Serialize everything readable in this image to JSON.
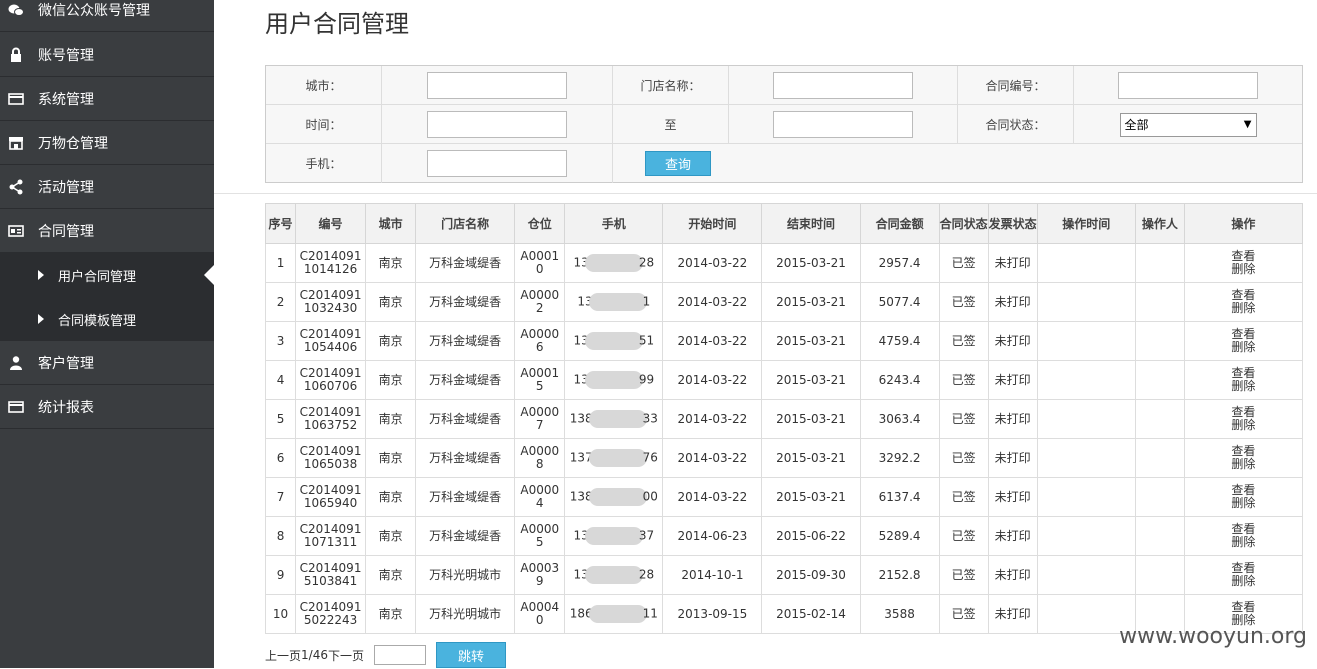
{
  "sidebar": {
    "items": [
      {
        "label": "微信公众账号管理",
        "icon": "wechat-icon"
      },
      {
        "label": "账号管理",
        "icon": "lock-icon"
      },
      {
        "label": "系统管理",
        "icon": "card-icon"
      },
      {
        "label": "万物仓管理",
        "icon": "store-icon"
      },
      {
        "label": "活动管理",
        "icon": "share-icon"
      },
      {
        "label": "合同管理",
        "icon": "contract-icon"
      },
      {
        "label": "客户管理",
        "icon": "user-icon"
      },
      {
        "label": "统计报表",
        "icon": "card-icon"
      }
    ],
    "sub_items": [
      {
        "label": "用户合同管理",
        "active": true
      },
      {
        "label": "合同模板管理",
        "active": false
      }
    ]
  },
  "page": {
    "title": "用户合同管理"
  },
  "filters": {
    "city_label": "城市：",
    "store_label": "门店名称：",
    "contract_no_label": "合同编号：",
    "time_label": "时间：",
    "to_label": "至",
    "status_label": "合同状态：",
    "status_value": "全部",
    "phone_label": "手机：",
    "query_button": "查询"
  },
  "table": {
    "headers": [
      "序号",
      "编号",
      "城市",
      "门店名称",
      "仓位",
      "手机",
      "开始时间",
      "结束时间",
      "合同金额",
      "合同状态",
      "发票状态",
      "操作时间",
      "操作人",
      "操作"
    ],
    "view_label": "查看",
    "delete_label": "删除",
    "rows": [
      {
        "idx": "1",
        "no1": "C2014091",
        "no2": "1014126",
        "city": "南京",
        "store": "万科金域缇香",
        "pos1": "A0001",
        "pos2": "0",
        "phone_a": "13",
        "phone_b": "28",
        "start": "2014-03-22",
        "end": "2015-03-21",
        "amount": "2957.4",
        "status": "已签",
        "invoice": "未打印",
        "optime": "",
        "operator": ""
      },
      {
        "idx": "2",
        "no1": "C2014091",
        "no2": "1032430",
        "city": "南京",
        "store": "万科金域缇香",
        "pos1": "A0000",
        "pos2": "2",
        "phone_a": "13",
        "phone_b": "1",
        "start": "2014-03-22",
        "end": "2015-03-21",
        "amount": "5077.4",
        "status": "已签",
        "invoice": "未打印",
        "optime": "",
        "operator": ""
      },
      {
        "idx": "3",
        "no1": "C2014091",
        "no2": "1054406",
        "city": "南京",
        "store": "万科金域缇香",
        "pos1": "A0000",
        "pos2": "6",
        "phone_a": "13",
        "phone_b": "51",
        "start": "2014-03-22",
        "end": "2015-03-21",
        "amount": "4759.4",
        "status": "已签",
        "invoice": "未打印",
        "optime": "",
        "operator": ""
      },
      {
        "idx": "4",
        "no1": "C2014091",
        "no2": "1060706",
        "city": "南京",
        "store": "万科金域缇香",
        "pos1": "A0001",
        "pos2": "5",
        "phone_a": "13",
        "phone_b": "99",
        "start": "2014-03-22",
        "end": "2015-03-21",
        "amount": "6243.4",
        "status": "已签",
        "invoice": "未打印",
        "optime": "",
        "operator": ""
      },
      {
        "idx": "5",
        "no1": "C2014091",
        "no2": "1063752",
        "city": "南京",
        "store": "万科金域缇香",
        "pos1": "A0000",
        "pos2": "7",
        "phone_a": "138",
        "phone_b": "33",
        "start": "2014-03-22",
        "end": "2015-03-21",
        "amount": "3063.4",
        "status": "已签",
        "invoice": "未打印",
        "optime": "",
        "operator": ""
      },
      {
        "idx": "6",
        "no1": "C2014091",
        "no2": "1065038",
        "city": "南京",
        "store": "万科金域缇香",
        "pos1": "A0000",
        "pos2": "8",
        "phone_a": "137",
        "phone_b": "76",
        "start": "2014-03-22",
        "end": "2015-03-21",
        "amount": "3292.2",
        "status": "已签",
        "invoice": "未打印",
        "optime": "",
        "operator": ""
      },
      {
        "idx": "7",
        "no1": "C2014091",
        "no2": "1065940",
        "city": "南京",
        "store": "万科金域缇香",
        "pos1": "A0000",
        "pos2": "4",
        "phone_a": "138",
        "phone_b": "00",
        "start": "2014-03-22",
        "end": "2015-03-21",
        "amount": "6137.4",
        "status": "已签",
        "invoice": "未打印",
        "optime": "",
        "operator": ""
      },
      {
        "idx": "8",
        "no1": "C2014091",
        "no2": "1071311",
        "city": "南京",
        "store": "万科金域缇香",
        "pos1": "A0000",
        "pos2": "5",
        "phone_a": "13",
        "phone_b": "37",
        "start": "2014-06-23",
        "end": "2015-06-22",
        "amount": "5289.4",
        "status": "已签",
        "invoice": "未打印",
        "optime": "",
        "operator": ""
      },
      {
        "idx": "9",
        "no1": "C2014091",
        "no2": "5103841",
        "city": "南京",
        "store": "万科光明城市",
        "pos1": "A0003",
        "pos2": "9",
        "phone_a": "13",
        "phone_b": "28",
        "start": "2014-10-1",
        "end": "2015-09-30",
        "amount": "2152.8",
        "status": "已签",
        "invoice": "未打印",
        "optime": "",
        "operator": ""
      },
      {
        "idx": "10",
        "no1": "C2014091",
        "no2": "5022243",
        "city": "南京",
        "store": "万科光明城市",
        "pos1": "A0004",
        "pos2": "0",
        "phone_a": "186",
        "phone_b": "11",
        "start": "2013-09-15",
        "end": "2015-02-14",
        "amount": "3588",
        "status": "已签",
        "invoice": "未打印",
        "optime": "",
        "operator": ""
      }
    ]
  },
  "pager": {
    "prev": "上一页",
    "info": "1/46",
    "next": "下一页",
    "jump_label": "跳转"
  },
  "watermark": "www.wooyun.org",
  "colors": {
    "sidebar_bg": "#3a3d40",
    "sidebar_sub_bg": "#2b2d30",
    "accent_blue": "#4ab3de"
  }
}
